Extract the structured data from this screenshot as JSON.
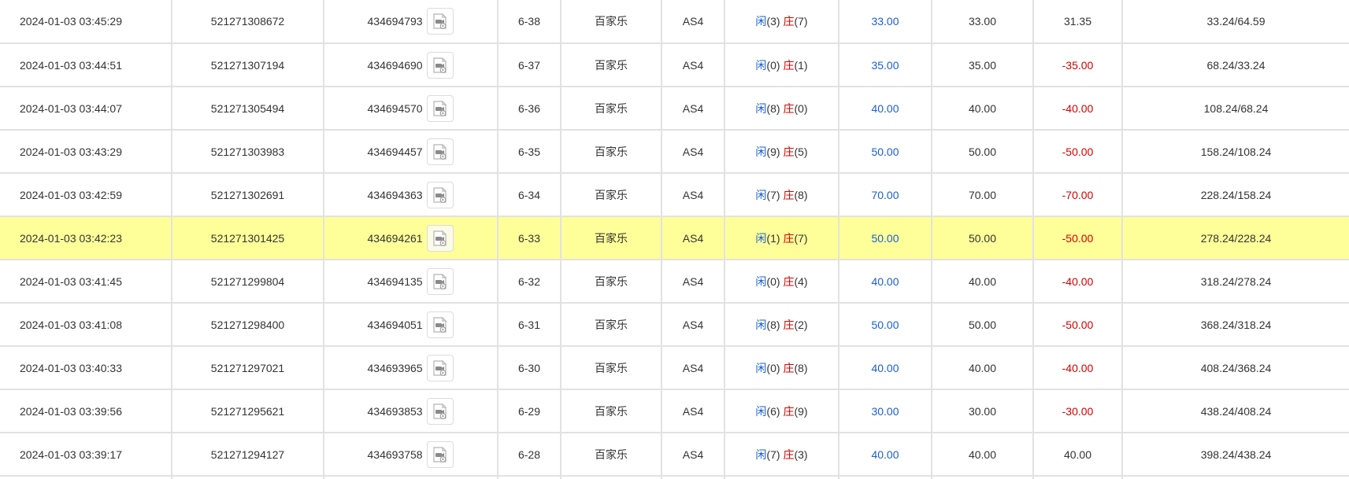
{
  "labels": {
    "player": "闲",
    "banker": "庄"
  },
  "colors": {
    "player_blue": "#1a5fd1",
    "banker_red": "#d40000",
    "highlight_row": "#ffff99",
    "grid_line": "#e2e2e2"
  },
  "icons": {
    "replay": "video-replay-icon"
  },
  "rows": [
    {
      "time": "2024-01-03 03:45:29",
      "order_id": "521271308672",
      "round_id": "434694793",
      "shoe": "6-38",
      "game": "百家乐",
      "table": "AS4",
      "player_pts": "(3)",
      "banker_pts": "(7)",
      "bet": "33.00",
      "valid_bet": "33.00",
      "win_loss": "31.35",
      "balance": "33.24/64.59",
      "win_color": "dark",
      "highlight": false
    },
    {
      "time": "2024-01-03 03:44:51",
      "order_id": "521271307194",
      "round_id": "434694690",
      "shoe": "6-37",
      "game": "百家乐",
      "table": "AS4",
      "player_pts": "(0)",
      "banker_pts": "(1)",
      "bet": "35.00",
      "valid_bet": "35.00",
      "win_loss": "-35.00",
      "balance": "68.24/33.24",
      "win_color": "red",
      "highlight": false
    },
    {
      "time": "2024-01-03 03:44:07",
      "order_id": "521271305494",
      "round_id": "434694570",
      "shoe": "6-36",
      "game": "百家乐",
      "table": "AS4",
      "player_pts": "(8)",
      "banker_pts": "(0)",
      "bet": "40.00",
      "valid_bet": "40.00",
      "win_loss": "-40.00",
      "balance": "108.24/68.24",
      "win_color": "red",
      "highlight": false
    },
    {
      "time": "2024-01-03 03:43:29",
      "order_id": "521271303983",
      "round_id": "434694457",
      "shoe": "6-35",
      "game": "百家乐",
      "table": "AS4",
      "player_pts": "(9)",
      "banker_pts": "(5)",
      "bet": "50.00",
      "valid_bet": "50.00",
      "win_loss": "-50.00",
      "balance": "158.24/108.24",
      "win_color": "red",
      "highlight": false
    },
    {
      "time": "2024-01-03 03:42:59",
      "order_id": "521271302691",
      "round_id": "434694363",
      "shoe": "6-34",
      "game": "百家乐",
      "table": "AS4",
      "player_pts": "(7)",
      "banker_pts": "(8)",
      "bet": "70.00",
      "valid_bet": "70.00",
      "win_loss": "-70.00",
      "balance": "228.24/158.24",
      "win_color": "red",
      "highlight": false
    },
    {
      "time": "2024-01-03 03:42:23",
      "order_id": "521271301425",
      "round_id": "434694261",
      "shoe": "6-33",
      "game": "百家乐",
      "table": "AS4",
      "player_pts": "(1)",
      "banker_pts": "(7)",
      "bet": "50.00",
      "valid_bet": "50.00",
      "win_loss": "-50.00",
      "balance": "278.24/228.24",
      "win_color": "red",
      "highlight": true
    },
    {
      "time": "2024-01-03 03:41:45",
      "order_id": "521271299804",
      "round_id": "434694135",
      "shoe": "6-32",
      "game": "百家乐",
      "table": "AS4",
      "player_pts": "(0)",
      "banker_pts": "(4)",
      "bet": "40.00",
      "valid_bet": "40.00",
      "win_loss": "-40.00",
      "balance": "318.24/278.24",
      "win_color": "red",
      "highlight": false
    },
    {
      "time": "2024-01-03 03:41:08",
      "order_id": "521271298400",
      "round_id": "434694051",
      "shoe": "6-31",
      "game": "百家乐",
      "table": "AS4",
      "player_pts": "(8)",
      "banker_pts": "(2)",
      "bet": "50.00",
      "valid_bet": "50.00",
      "win_loss": "-50.00",
      "balance": "368.24/318.24",
      "win_color": "red",
      "highlight": false
    },
    {
      "time": "2024-01-03 03:40:33",
      "order_id": "521271297021",
      "round_id": "434693965",
      "shoe": "6-30",
      "game": "百家乐",
      "table": "AS4",
      "player_pts": "(0)",
      "banker_pts": "(8)",
      "bet": "40.00",
      "valid_bet": "40.00",
      "win_loss": "-40.00",
      "balance": "408.24/368.24",
      "win_color": "red",
      "highlight": false
    },
    {
      "time": "2024-01-03 03:39:56",
      "order_id": "521271295621",
      "round_id": "434693853",
      "shoe": "6-29",
      "game": "百家乐",
      "table": "AS4",
      "player_pts": "(6)",
      "banker_pts": "(9)",
      "bet": "30.00",
      "valid_bet": "30.00",
      "win_loss": "-30.00",
      "balance": "438.24/408.24",
      "win_color": "red",
      "highlight": false
    },
    {
      "time": "2024-01-03 03:39:17",
      "order_id": "521271294127",
      "round_id": "434693758",
      "shoe": "6-28",
      "game": "百家乐",
      "table": "AS4",
      "player_pts": "(7)",
      "banker_pts": "(3)",
      "bet": "40.00",
      "valid_bet": "40.00",
      "win_loss": "40.00",
      "balance": "398.24/438.24",
      "win_color": "dark",
      "highlight": false
    }
  ]
}
